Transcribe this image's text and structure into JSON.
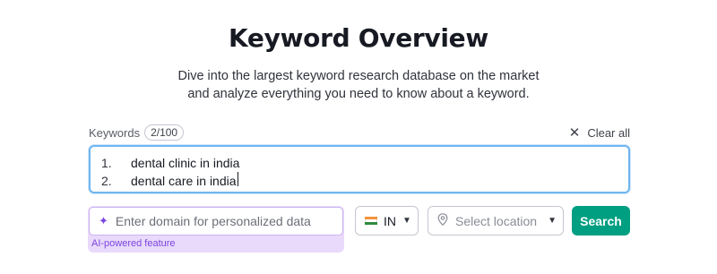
{
  "header": {
    "title": "Keyword Overview",
    "subtitle_line1": "Dive into the largest keyword research database on the market",
    "subtitle_line2": "and analyze everything you need to know about a keyword."
  },
  "keywords": {
    "label": "Keywords",
    "count": "2/100",
    "clear_label": "Clear all",
    "items": [
      {
        "num": "1.",
        "text": "dental clinic in india"
      },
      {
        "num": "2.",
        "text": "dental care in india"
      }
    ]
  },
  "domain_input": {
    "placeholder": "Enter domain for personalized data",
    "value": "",
    "note": "AI-powered feature"
  },
  "database": {
    "selected": "IN"
  },
  "location": {
    "placeholder": "Select location"
  },
  "search_button": {
    "label": "Search",
    "color": "#009f81"
  },
  "icons": {
    "clear": "close-icon",
    "ai": "sparkle-icon",
    "flag": "india-flag-icon",
    "location": "location-pin-icon",
    "chevron": "chevron-down-icon"
  }
}
